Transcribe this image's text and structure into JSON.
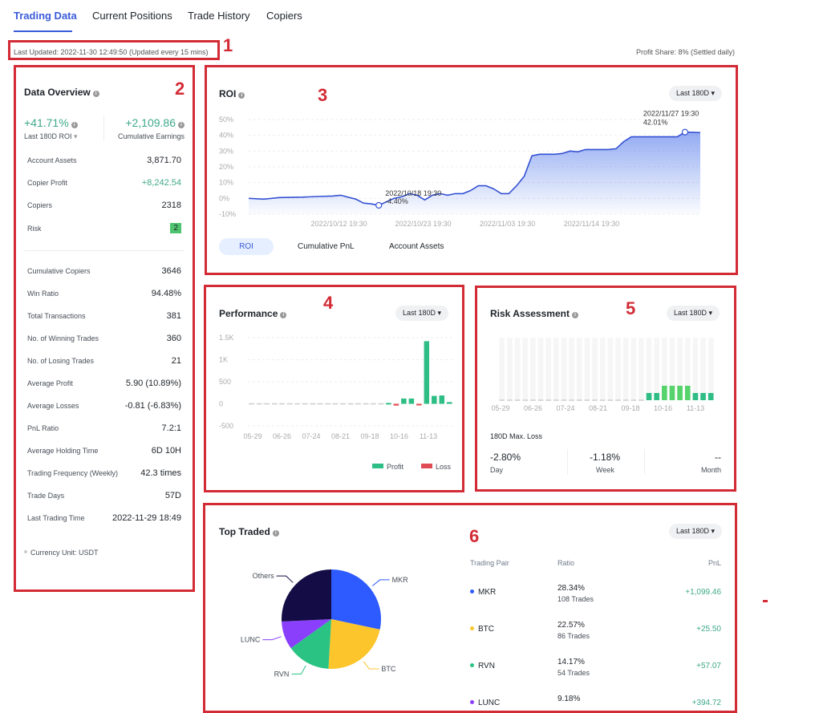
{
  "tabs": [
    {
      "label": "Trading Data",
      "active": true
    },
    {
      "label": "Current Positions"
    },
    {
      "label": "Trade History"
    },
    {
      "label": "Copiers"
    }
  ],
  "last_updated": "Last Updated: 2022-11-30 12:49:50 (Updated every 15 mins)",
  "profit_share": "Profit Share: 8% (Settled daily)",
  "annotations": [
    "1",
    "2",
    "3",
    "4",
    "5",
    "6"
  ],
  "colors": {
    "accent": "#3a5bd9",
    "profit": "#2ebd85",
    "loss": "#e04c55",
    "annotation": "#d32b35"
  },
  "overview": {
    "title": "Data Overview",
    "roi_value": "+41.71%",
    "roi_label": "Last 180D ROI",
    "earnings_value": "+2,109.86",
    "earnings_label": "Cumulative Earnings",
    "rows1": [
      {
        "label": "Account Assets",
        "value": "3,871.70"
      },
      {
        "label": "Copier Profit",
        "value": "+8,242.54"
      },
      {
        "label": "Copiers",
        "value": "2318"
      },
      {
        "label": "Risk",
        "value": "2"
      }
    ],
    "rows2": [
      {
        "label": "Cumulative Copiers",
        "value": "3646"
      },
      {
        "label": "Win Ratio",
        "value": "94.48%"
      },
      {
        "label": "Total Transactions",
        "value": "381"
      },
      {
        "label": "No. of Winning Trades",
        "value": "360"
      },
      {
        "label": "No. of Losing Trades",
        "value": "21"
      },
      {
        "label": "Average Profit",
        "value": "5.90 (10.89%)"
      },
      {
        "label": "Average Losses",
        "value": "-0.81 (-6.83%)"
      },
      {
        "label": "PnL Ratio",
        "value": "7.2:1"
      },
      {
        "label": "Average Holding Time",
        "value": "6D 10H"
      },
      {
        "label": "Trading Frequency (Weekly)",
        "value": "42.3 times"
      },
      {
        "label": "Trade Days",
        "value": "57D"
      },
      {
        "label": "Last Trading Time",
        "value": "2022-11-29 18:49"
      }
    ],
    "currency": "Currency Unit: USDT"
  },
  "roi": {
    "title": "ROI",
    "period": "Last 180D",
    "subtabs": [
      "ROI",
      "Cumulative PnL",
      "Account Assets"
    ],
    "active_subtab": "ROI"
  },
  "performance": {
    "title": "Performance",
    "period": "Last 180D",
    "legend": [
      "Profit",
      "Loss"
    ]
  },
  "risk": {
    "title": "Risk Assessment",
    "period": "Last 180D",
    "max_loss_label": "180D Max. Loss",
    "stats": [
      {
        "value": "-2.80%",
        "label": "Day"
      },
      {
        "value": "-1.18%",
        "label": "Week"
      },
      {
        "value": "--",
        "label": "Month"
      }
    ]
  },
  "top_traded": {
    "title": "Top Traded",
    "period": "Last 180D",
    "headers": [
      "Trading Pair",
      "Ratio",
      "PnL"
    ],
    "rows": [
      {
        "pair": "MKR",
        "ratio": "28.34%",
        "trades": "108 Trades",
        "pnl": "+1,099.46",
        "color": "#2d5bff"
      },
      {
        "pair": "BTC",
        "ratio": "22.57%",
        "trades": "86 Trades",
        "pnl": "+25.50",
        "color": "#fcc52c"
      },
      {
        "pair": "RVN",
        "ratio": "14.17%",
        "trades": "54 Trades",
        "pnl": "+57.07",
        "color": "#2ac384"
      },
      {
        "pair": "LUNC",
        "ratio": "9.18%",
        "trades": "",
        "pnl": "+394.72",
        "color": "#8a3ffc"
      }
    ]
  },
  "chart_data": [
    {
      "type": "area",
      "title": "ROI",
      "ylim": [
        -10,
        50
      ],
      "yticks": [
        "50%",
        "40%",
        "30%",
        "20%",
        "10%",
        "0%",
        "-10%"
      ],
      "xticks": [
        "2022/10/12 19:30",
        "2022/10/23 19:30",
        "2022/11/03 19:30",
        "2022/11/14 19:30"
      ],
      "grid": true,
      "annotations": [
        {
          "date": "2022/10/18 19:30",
          "value": "-4.40%"
        },
        {
          "date": "2022/11/27 19:30",
          "value": "42.01%"
        }
      ],
      "x": [
        "10/01",
        "10/03",
        "10/05",
        "10/08",
        "10/10",
        "10/12",
        "10/13",
        "10/15",
        "10/16",
        "10/17",
        "10/18",
        "10/20",
        "10/21",
        "10/22",
        "10/23",
        "10/24",
        "10/25",
        "10/26",
        "10/27",
        "10/28",
        "10/29",
        "10/30",
        "10/31",
        "11/01",
        "11/02",
        "11/03",
        "11/04",
        "11/05",
        "11/06",
        "11/07",
        "11/08",
        "11/10",
        "11/11",
        "11/12",
        "11/13",
        "11/14",
        "11/17",
        "11/18",
        "11/19",
        "11/20",
        "11/23",
        "11/26",
        "11/27",
        "11/29"
      ],
      "values": [
        0,
        -0.5,
        0.5,
        0.8,
        1.2,
        1.5,
        2,
        -0.5,
        -3,
        -3.5,
        -4.4,
        0,
        1,
        3,
        2,
        -1,
        2,
        3,
        2,
        3,
        3,
        5,
        8,
        8,
        6,
        3,
        3,
        8,
        14,
        27,
        28,
        28,
        28.5,
        30,
        29.5,
        31,
        31,
        31.5,
        36,
        39,
        39,
        39,
        42.01,
        41.7
      ]
    },
    {
      "type": "bar",
      "title": "Performance",
      "ylim": [
        -500,
        1500
      ],
      "yticks": [
        "1.5K",
        "1K",
        "500",
        "0",
        "-500"
      ],
      "xticks": [
        "05-29",
        "06-26",
        "07-24",
        "08-21",
        "09-18",
        "10-16",
        "11-13"
      ],
      "grid": true,
      "legend": "bottom-right",
      "values": [
        0,
        0,
        0,
        0,
        0,
        0,
        0,
        0,
        0,
        0,
        0,
        0,
        0,
        0,
        0,
        0,
        0,
        0,
        20,
        -40,
        120,
        120,
        -5,
        1420,
        180,
        190,
        40
      ]
    },
    {
      "type": "bar",
      "title": "Risk Assessment",
      "ylim": [
        0,
        5
      ],
      "xticks": [
        "05-29",
        "06-26",
        "07-24",
        "08-21",
        "09-18",
        "10-16",
        "11-13"
      ],
      "values": [
        0,
        0,
        0,
        0,
        0,
        0,
        0,
        0,
        0,
        0,
        0,
        0,
        0,
        0,
        0,
        0,
        0,
        0,
        0,
        1,
        1,
        2,
        2,
        2,
        2,
        1,
        1,
        1
      ]
    },
    {
      "type": "pie",
      "title": "Top Traded",
      "categories": [
        "MKR",
        "BTC",
        "RVN",
        "LUNC",
        "Others"
      ],
      "values": [
        28.34,
        22.57,
        14.17,
        9.18,
        25.74
      ],
      "colors": [
        "#2d5bff",
        "#fcc52c",
        "#2ac384",
        "#8a3ffc",
        "#130c45"
      ]
    }
  ]
}
